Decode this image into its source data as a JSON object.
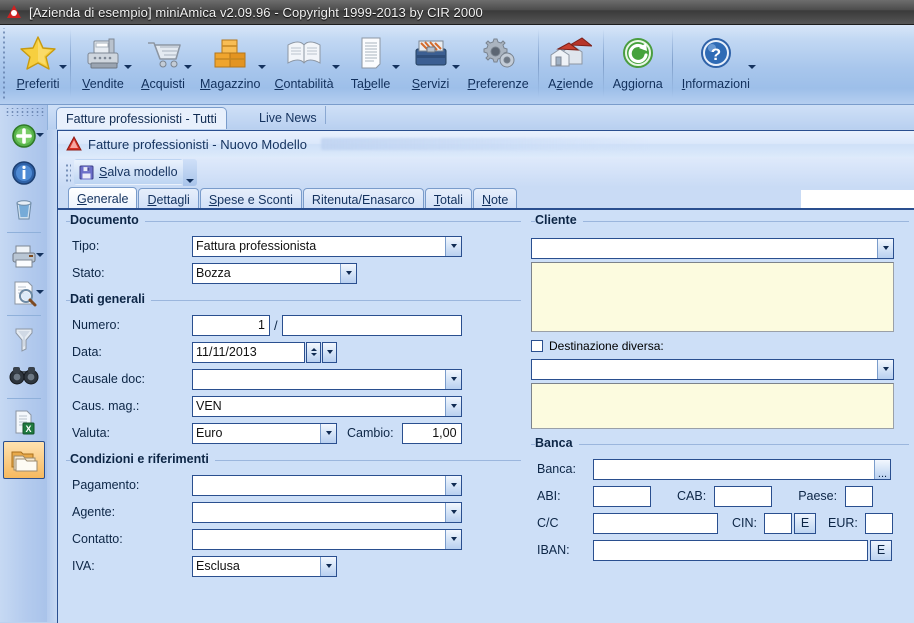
{
  "window": {
    "title": "[Azienda di esempio] miniAmica v2.09.96 - Copyright 1999-2013 by CIR 2000",
    "logo_icon": "triangle-warning-icon"
  },
  "ribbon": {
    "buttons": [
      {
        "label": "Preferiti",
        "icon": "star-icon",
        "arrow": true
      },
      {
        "label": "Vendite",
        "icon": "cash-register-icon",
        "arrow": true
      },
      {
        "label": "Acquisti",
        "icon": "shopping-cart-icon",
        "arrow": true
      },
      {
        "label": "Magazzino",
        "icon": "boxes-icon",
        "arrow": true
      },
      {
        "label": "Contabilità",
        "icon": "ledger-book-icon",
        "arrow": true
      },
      {
        "label": "Tabelle",
        "icon": "document-list-icon",
        "arrow": true
      },
      {
        "label": "Servizi",
        "icon": "toolbox-icon",
        "arrow": true
      },
      {
        "label": "Preferenze",
        "icon": "gears-icon",
        "arrow": false
      },
      {
        "label": "Aziende",
        "icon": "houses-icon",
        "arrow": false
      },
      {
        "label": "Aggiorna",
        "icon": "refresh-green-icon",
        "arrow": false
      },
      {
        "label": "Informazioni",
        "icon": "help-question-icon",
        "arrow": true
      }
    ]
  },
  "doc_tabs": [
    {
      "label": "Fatture professionisti - Tutti",
      "active": true
    },
    {
      "label": "Live News",
      "active": false
    }
  ],
  "rail": {
    "items": [
      {
        "icon": "add-green-plus-icon",
        "arrow": true,
        "selected": false
      },
      {
        "icon": "info-blue-icon",
        "arrow": false,
        "selected": false
      },
      {
        "icon": "trash-bin-icon",
        "arrow": false,
        "selected": false
      },
      {
        "icon": "printer-icon",
        "arrow": true,
        "selected": false
      },
      {
        "icon": "print-preview-icon",
        "arrow": true,
        "selected": false
      },
      {
        "icon": "filter-funnel-icon",
        "arrow": false,
        "selected": false
      },
      {
        "icon": "binoculars-icon",
        "arrow": false,
        "selected": false
      },
      {
        "icon": "export-excel-icon",
        "arrow": false,
        "selected": false
      },
      {
        "icon": "folders-icon",
        "arrow": false,
        "selected": true
      }
    ]
  },
  "document_window": {
    "title": "Fatture professionisti - Nuovo Modello",
    "title_icon": "triangle-warning-icon",
    "command_bar": {
      "save_label": "Salva modello",
      "save_icon": "floppy-disk-icon",
      "split_icon": "chevron-down-icon"
    },
    "tabs": [
      {
        "label": "Generale",
        "active": true
      },
      {
        "label": "Dettagli",
        "active": false
      },
      {
        "label": "Spese e Sconti",
        "active": false
      },
      {
        "label": "Ritenuta/Enasarco",
        "active": false
      },
      {
        "label": "Totali",
        "active": false
      },
      {
        "label": "Note",
        "active": false
      }
    ]
  },
  "form": {
    "left": {
      "group_documento": "Documento",
      "tipo_label": "Tipo:",
      "tipo_value": "Fattura professionista",
      "stato_label": "Stato:",
      "stato_value": "Bozza",
      "group_dati_generali": "Dati generali",
      "numero_label": "Numero:",
      "numero_value": "1",
      "numero_separator": "/",
      "numero_suffix_value": "",
      "data_label": "Data:",
      "data_value": "11/11/2013",
      "causale_doc_label": "Causale doc:",
      "causale_doc_value": "",
      "caus_mag_label": "Caus. mag.:",
      "caus_mag_value": "VEN",
      "valuta_label": "Valuta:",
      "valuta_value": "Euro",
      "cambio_label": "Cambio:",
      "cambio_value": "1,00",
      "group_condizioni": "Condizioni e riferimenti",
      "pagamento_label": "Pagamento:",
      "pagamento_value": "",
      "agente_label": "Agente:",
      "agente_value": "",
      "contatto_label": "Contatto:",
      "contatto_value": "",
      "iva_label": "IVA:",
      "iva_value": "Esclusa"
    },
    "right": {
      "group_cliente": "Cliente",
      "cliente_value": "",
      "cliente_memo": "",
      "destinazione_label": "Destinazione diversa:",
      "destinazione_checked": false,
      "destinazione_value": "",
      "destinazione_memo": "",
      "group_banca": "Banca",
      "banca_label": "Banca:",
      "banca_value": "",
      "banca_browse": "...",
      "abi_label": "ABI:",
      "abi_value": "",
      "cab_label": "CAB:",
      "cab_value": "",
      "paese_label": "Paese:",
      "paese_value": "",
      "cc_label": "C/C",
      "cc_value": "",
      "cin_label": "CIN:",
      "cin_value": "",
      "cin_calc_label": "E",
      "eur_label": "EUR:",
      "eur_value": "",
      "iban_label": "IBAN:",
      "iban_value": "",
      "iban_calc_label": "E"
    }
  },
  "colors": {
    "window_bg": "#cddff7",
    "accent_border": "#2a4f8f",
    "memo_yellow": "#fcfbdf",
    "selected_rail": "#f6b95f"
  }
}
